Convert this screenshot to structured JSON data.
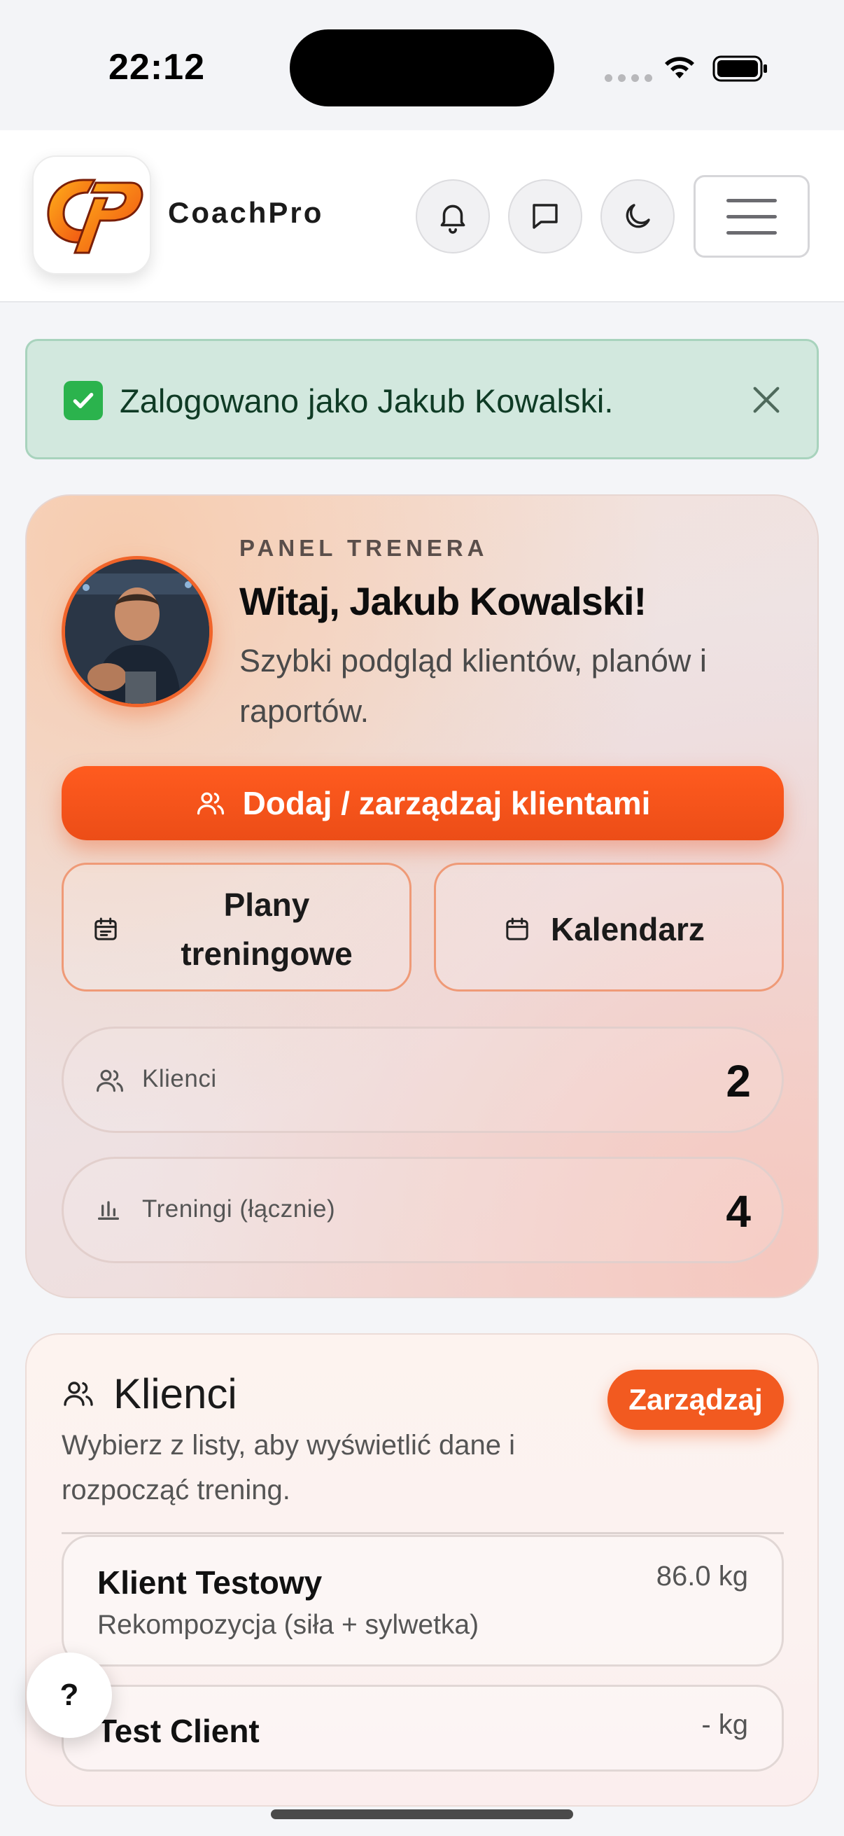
{
  "status_bar": {
    "time": "22:12"
  },
  "header": {
    "brand": "CoachPro",
    "logo_letters": "CP",
    "icons": [
      "bell-icon",
      "chat-icon",
      "moon-icon",
      "menu-icon"
    ]
  },
  "alert": {
    "text": "Zalogowano jako Jakub Kowalski."
  },
  "hero": {
    "kicker": "PANEL TRENERA",
    "title": "Witaj, Jakub Kowalski!",
    "subtitle": "Szybki podgląd klientów, planów i raportów.",
    "primary_action": "Dodaj / zarządzaj klientami",
    "plans_button": "Plany treningowe",
    "calendar_button": "Kalendarz",
    "stats": [
      {
        "label": "Klienci",
        "value": "2",
        "icon": "users-icon"
      },
      {
        "label": "Treningi (łącznie)",
        "value": "4",
        "icon": "bar-chart-icon"
      }
    ]
  },
  "clients": {
    "title": "Klienci",
    "subtitle": "Wybierz z listy, aby wyświetlić dane i rozpocząć trening.",
    "manage_button": "Zarządzaj",
    "items": [
      {
        "name": "Klient Testowy",
        "goal": "Rekompozycja (siła + sylwetka)",
        "weight": "86.0 kg"
      },
      {
        "name": "Test Client",
        "goal": "",
        "weight": "- kg"
      }
    ]
  },
  "help": {
    "label": "?"
  },
  "colors": {
    "accent": "#f25a20",
    "alert_bg": "#d2e8de",
    "alert_border": "#a8d3bd"
  }
}
